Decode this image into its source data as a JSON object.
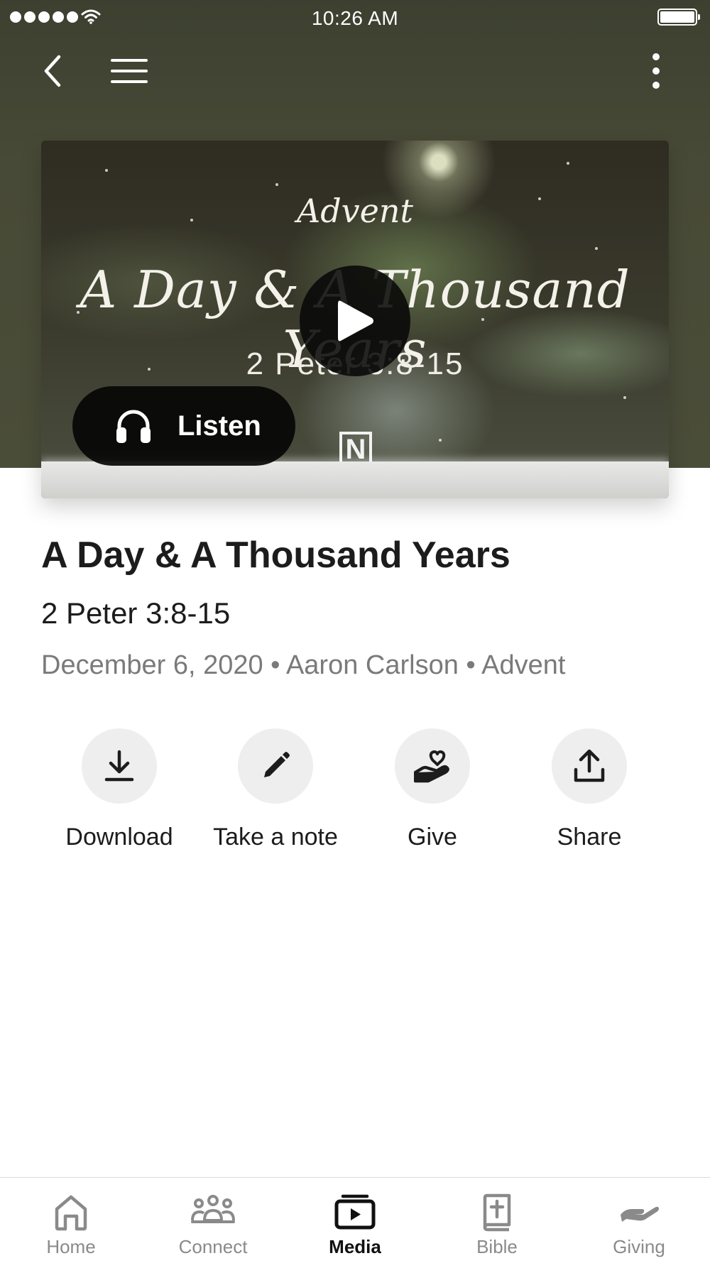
{
  "status_bar": {
    "time": "10:26 AM"
  },
  "media": {
    "artwork_series_script": "Advent",
    "artwork_title_script": "A Day & A Thousand Years",
    "artwork_reference": "2 Peter 3:8-15",
    "artwork_logo": "N",
    "listen_label": "Listen"
  },
  "sermon": {
    "title": "A Day & A Thousand Years",
    "reference": "2 Peter 3:8-15",
    "meta": "December 6, 2020 • Aaron Carlson • Advent"
  },
  "actions": [
    {
      "label": "Download",
      "icon": "download-icon"
    },
    {
      "label": "Take a note",
      "icon": "pencil-icon"
    },
    {
      "label": "Give",
      "icon": "give-heart-hand-icon"
    },
    {
      "label": "Share",
      "icon": "share-icon"
    }
  ],
  "tabs": [
    {
      "label": "Home",
      "icon": "home-icon",
      "active": false
    },
    {
      "label": "Connect",
      "icon": "people-icon",
      "active": false
    },
    {
      "label": "Media",
      "icon": "media-icon",
      "active": true
    },
    {
      "label": "Bible",
      "icon": "bible-icon",
      "active": false
    },
    {
      "label": "Giving",
      "icon": "giving-icon",
      "active": false
    }
  ],
  "colors": {
    "header_bg": "#474a36",
    "tab_active": "#111111",
    "tab_inactive": "#8a8a8a",
    "action_circle": "#eeeeee"
  }
}
